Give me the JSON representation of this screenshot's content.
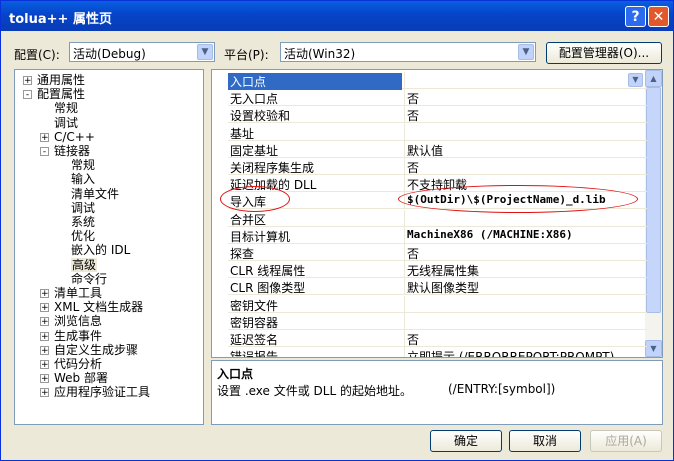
{
  "window": {
    "title": "tolua++ 属性页",
    "help_glyph": "?",
    "close_glyph": "✕"
  },
  "config": {
    "label": "配置(C):",
    "value": "活动(Debug)"
  },
  "platform": {
    "label": "平台(P):",
    "value": "活动(Win32)"
  },
  "config_manager_label": "配置管理器(O)...",
  "tree": [
    {
      "label": "通用属性",
      "level": 0,
      "toggle": "+"
    },
    {
      "label": "配置属性",
      "level": 0,
      "toggle": "-"
    },
    {
      "label": "常规",
      "level": 1,
      "toggle": ""
    },
    {
      "label": "调试",
      "level": 1,
      "toggle": ""
    },
    {
      "label": "C/C++",
      "level": 1,
      "toggle": "+"
    },
    {
      "label": "链接器",
      "level": 1,
      "toggle": "-"
    },
    {
      "label": "常规",
      "level": 2,
      "toggle": ""
    },
    {
      "label": "输入",
      "level": 2,
      "toggle": ""
    },
    {
      "label": "清单文件",
      "level": 2,
      "toggle": ""
    },
    {
      "label": "调试",
      "level": 2,
      "toggle": ""
    },
    {
      "label": "系统",
      "level": 2,
      "toggle": ""
    },
    {
      "label": "优化",
      "level": 2,
      "toggle": ""
    },
    {
      "label": "嵌入的 IDL",
      "level": 2,
      "toggle": ""
    },
    {
      "label": "高级",
      "level": 2,
      "toggle": "",
      "selected": true
    },
    {
      "label": "命令行",
      "level": 2,
      "toggle": ""
    },
    {
      "label": "清单工具",
      "level": 1,
      "toggle": "+"
    },
    {
      "label": "XML 文档生成器",
      "level": 1,
      "toggle": "+"
    },
    {
      "label": "浏览信息",
      "level": 1,
      "toggle": "+"
    },
    {
      "label": "生成事件",
      "level": 1,
      "toggle": "+"
    },
    {
      "label": "自定义生成步骤",
      "level": 1,
      "toggle": "+"
    },
    {
      "label": "代码分析",
      "level": 1,
      "toggle": "+"
    },
    {
      "label": "Web 部署",
      "level": 1,
      "toggle": "+"
    },
    {
      "label": "应用程序验证工具",
      "level": 1,
      "toggle": "+"
    }
  ],
  "properties": [
    {
      "name": "入口点",
      "value": "",
      "selected": true
    },
    {
      "name": "无入口点",
      "value": "否"
    },
    {
      "name": "设置校验和",
      "value": "否"
    },
    {
      "name": "基址",
      "value": ""
    },
    {
      "name": "固定基址",
      "value": "默认值"
    },
    {
      "name": "关闭程序集生成",
      "value": "否"
    },
    {
      "name": "延迟加载的 DLL",
      "value": "不支持卸载"
    },
    {
      "name": "导入库",
      "value": "$(OutDir)\\$(ProjectName)_d.lib",
      "bold": true,
      "circled": true
    },
    {
      "name": "合并区",
      "value": ""
    },
    {
      "name": "目标计算机",
      "value": "MachineX86 (/MACHINE:X86)",
      "bold": true
    },
    {
      "name": "探查",
      "value": "否"
    },
    {
      "name": "CLR 线程属性",
      "value": "无线程属性集"
    },
    {
      "name": "CLR 图像类型",
      "value": "默认图像类型"
    },
    {
      "name": "密钥文件",
      "value": ""
    },
    {
      "name": "密钥容器",
      "value": ""
    },
    {
      "name": "延迟签名",
      "value": "否"
    },
    {
      "name": "错误报告",
      "value": "立即提示 (/ERRORREPORT:PROMPT)"
    }
  ],
  "description": {
    "title": "入口点",
    "text": "设置 .exe 文件或 DLL 的起始地址。",
    "switch": "(/ENTRY:[symbol])"
  },
  "buttons": {
    "ok": "确定",
    "cancel": "取消",
    "apply": "应用(A)"
  },
  "colors": {
    "selection": "#316ac5",
    "annotation": "#e01010",
    "title_bar": "#0544c9"
  }
}
